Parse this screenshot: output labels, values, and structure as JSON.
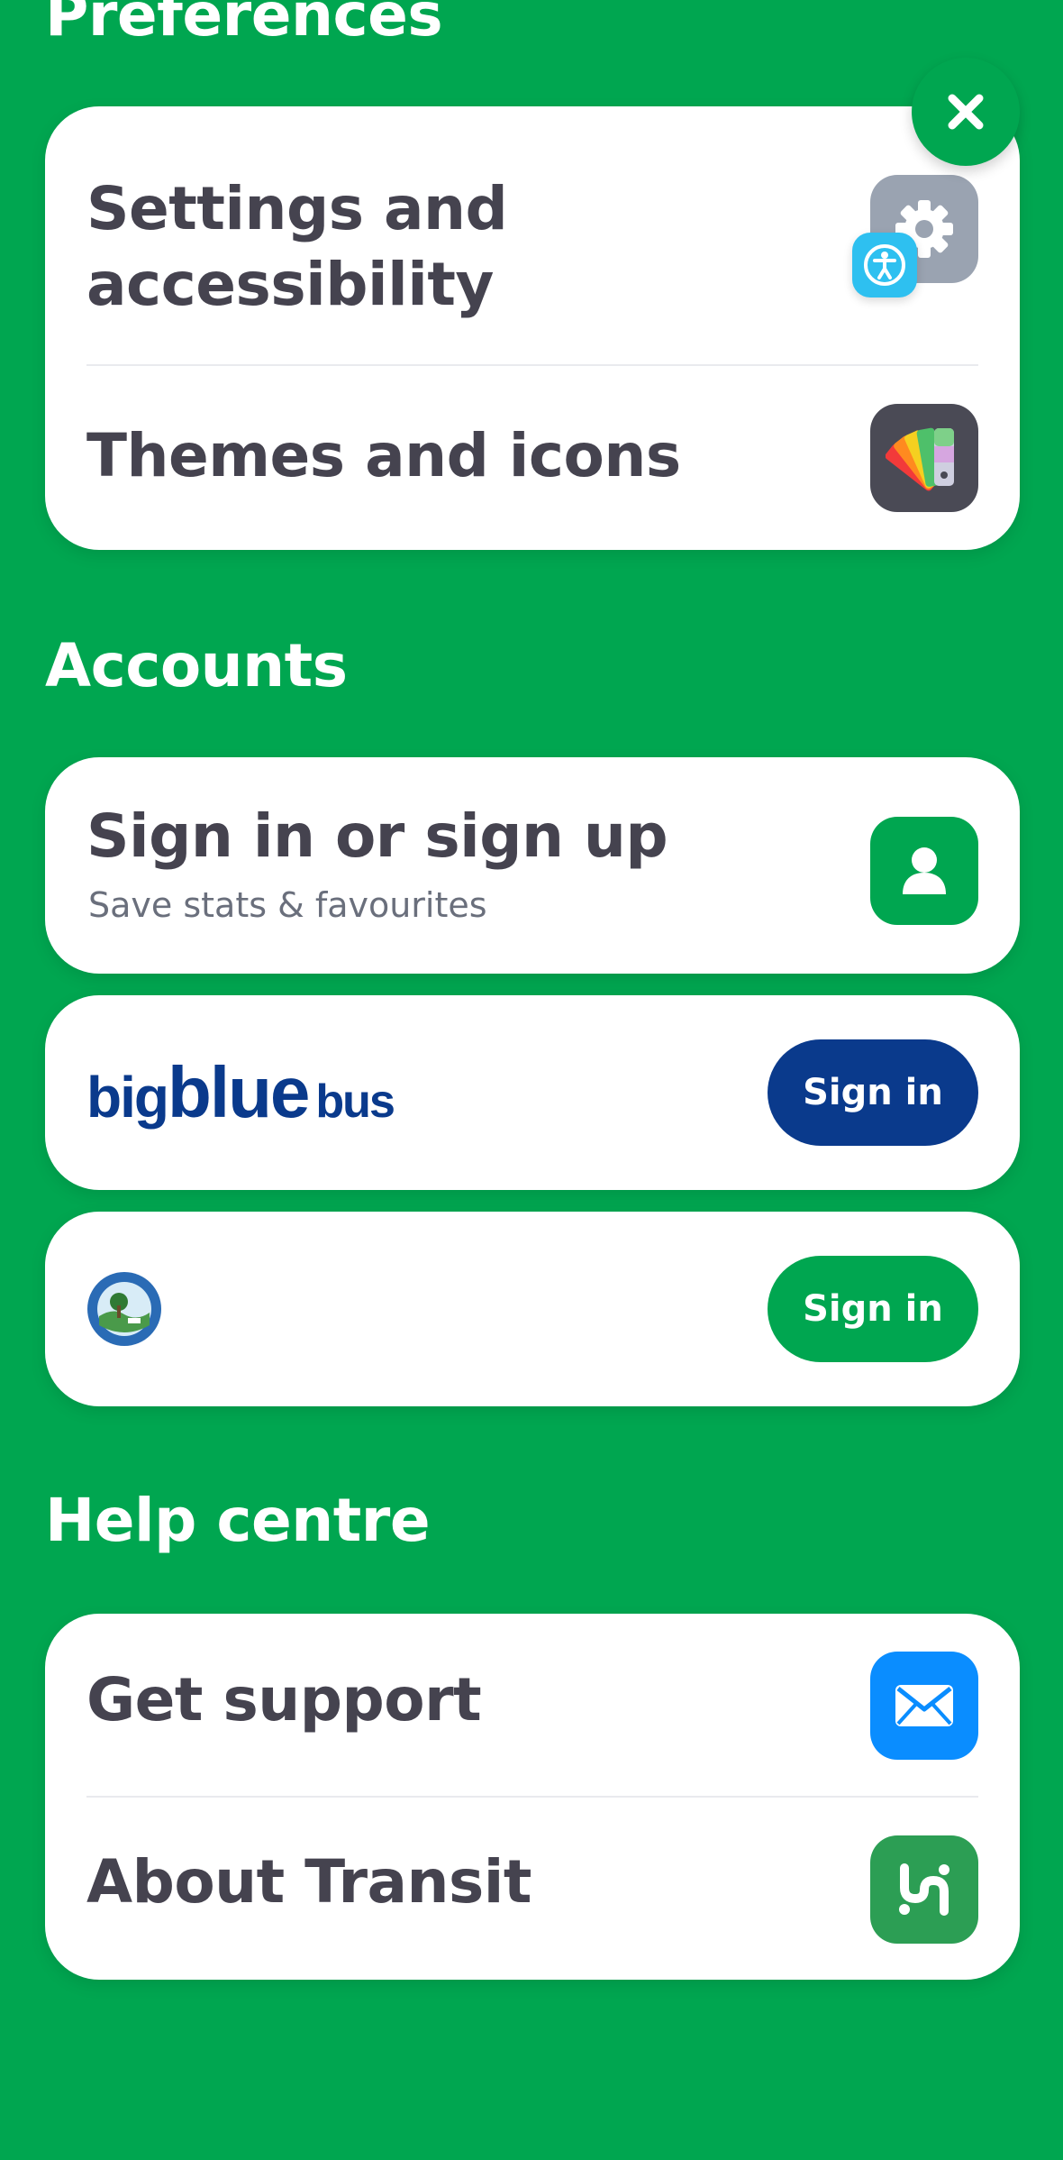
{
  "colors": {
    "background": "#00a650",
    "card": "#ffffff",
    "text_primary": "#45434f",
    "text_secondary": "#6a6f7c",
    "bigbluebus_navy": "#0a3a8c",
    "transit_green": "#00a650",
    "support_blue": "#0a8dff",
    "accessibility_blue": "#2ec0f0"
  },
  "close_button": {
    "icon": "close-icon"
  },
  "preferences": {
    "title": "Preferences",
    "items": [
      {
        "label": "Settings and accessibility",
        "icon": "gear-icon",
        "badge_icon": "accessibility-icon"
      },
      {
        "label": "Themes and icons",
        "icon": "palette-icon"
      }
    ]
  },
  "accounts": {
    "title": "Accounts",
    "signin_card": {
      "title": "Sign in or sign up",
      "subtitle": "Save stats & favourites",
      "icon": "person-icon"
    },
    "agencies": [
      {
        "logo_text_a": "big",
        "logo_text_b": "blue",
        "logo_text_c": "bus",
        "button": "Sign in",
        "button_color": "#0a3a8c"
      },
      {
        "logo": "city-seal-logo",
        "button": "Sign in",
        "button_color": "#00a650"
      }
    ]
  },
  "help": {
    "title": "Help centre",
    "items": [
      {
        "label": "Get support",
        "icon": "mail-icon"
      },
      {
        "label": "About Transit",
        "icon": "transit-logo-icon"
      }
    ]
  }
}
